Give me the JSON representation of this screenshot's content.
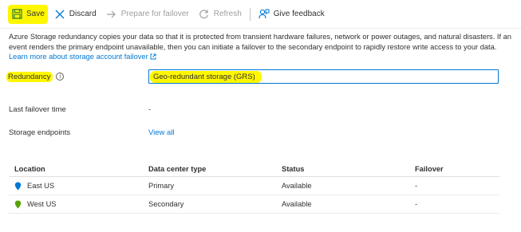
{
  "toolbar": {
    "save_label": "Save",
    "discard_label": "Discard",
    "failover_label": "Prepare for failover",
    "refresh_label": "Refresh",
    "feedback_label": "Give feedback"
  },
  "description": {
    "text": "Azure Storage redundancy copies your data so that it is protected from transient hardware failures, network or power outages, and natural disasters. If an event renders the primary endpoint unavailable, then you can initiate a failover to the secondary endpoint to rapidly restore write access to your data.",
    "link_text": "Learn more about storage account failover"
  },
  "form": {
    "redundancy_label": "Redundancy",
    "redundancy_value": "Geo-redundant storage (GRS)",
    "last_failover_label": "Last failover time",
    "last_failover_value": "-",
    "endpoints_label": "Storage endpoints",
    "endpoints_link": "View all"
  },
  "table": {
    "headers": [
      "Location",
      "Data center type",
      "Status",
      "Failover"
    ],
    "rows": [
      {
        "location": "East US",
        "type": "Primary",
        "status": "Available",
        "failover": "-",
        "pin_color": "#0078d4"
      },
      {
        "location": "West US",
        "type": "Secondary",
        "status": "Available",
        "failover": "-",
        "pin_color": "#57a300"
      }
    ]
  },
  "colors": {
    "accent": "#0078d4",
    "highlight": "#fff700",
    "save_icon": "#2e7d32",
    "pin_primary": "#0078d4",
    "pin_secondary": "#57a300"
  }
}
